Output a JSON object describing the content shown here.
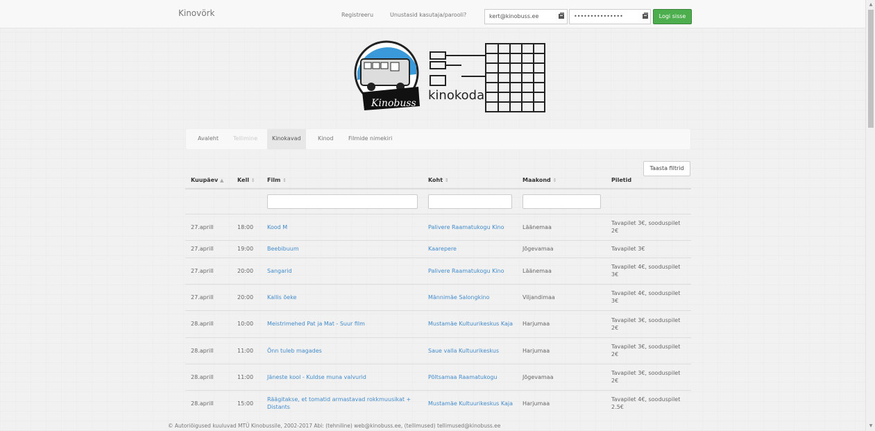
{
  "topbar": {
    "brand": "Kinovörk",
    "register": "Registreeru",
    "forgot": "Unustasid kasutaja/parooli?",
    "email_value": "kert@kinobuss.ee",
    "password_value": "•••••••••••••••",
    "login_label": "Logi sisse"
  },
  "logo": {
    "text": "kinokoda",
    "bus_text": "Kinobuss"
  },
  "tabs": [
    "Avaleht",
    "Tellimine",
    "Kinokavad",
    "Kinod",
    "Filmide nimekiri"
  ],
  "table": {
    "reset_label": "Taasta filtrid",
    "headers": [
      "Kuupäev",
      "Kell",
      "Film",
      "Koht",
      "Maakond",
      "Piletid"
    ],
    "sort_active": "▲",
    "sort_inactive": "⇕",
    "rows": [
      {
        "date": "27.aprill",
        "time": "18:00",
        "film": "Kood M",
        "place": "Palivere Raamatukogu Kino",
        "county": "Läänemaa",
        "tickets": "Tavapilet 3€, sooduspilet 2€"
      },
      {
        "date": "27.aprill",
        "time": "19:00",
        "film": "Beebibuum",
        "place": "Kaarepere",
        "county": "Jõgevamaa",
        "tickets": "Tavapilet 3€"
      },
      {
        "date": "27.aprill",
        "time": "20:00",
        "film": "Sangarid",
        "place": "Palivere Raamatukogu Kino",
        "county": "Läänemaa",
        "tickets": "Tavapilet 4€, sooduspilet 3€"
      },
      {
        "date": "27.aprill",
        "time": "20:00",
        "film": "Kallis õeke",
        "place": "Männimäe Salongkino",
        "county": "Viljandimaa",
        "tickets": "Tavapilet 4€, sooduspilet 3€"
      },
      {
        "date": "28.aprill",
        "time": "10:00",
        "film": "Meistrimehed Pat ja Mat - Suur film",
        "place": "Mustamäe Kultuurikeskus Kaja",
        "county": "Harjumaa",
        "tickets": "Tavapilet 3€, sooduspilet 2€"
      },
      {
        "date": "28.aprill",
        "time": "11:00",
        "film": "Õnn tuleb magades",
        "place": "Saue valla Kultuurikeskus",
        "county": "Harjumaa",
        "tickets": "Tavapilet 3€, sooduspilet 2€"
      },
      {
        "date": "28.aprill",
        "time": "11:00",
        "film": "Jäneste kool - Kuldse muna valvurid",
        "place": "Põltsamaa Raamatukogu",
        "county": "Jõgevamaa",
        "tickets": "Tavapilet 3€, sooduspilet 2€"
      },
      {
        "date": "28.aprill",
        "time": "15:00",
        "film": "Räägitakse, et tomatid armastavad rokkmuusikat + Distants",
        "place": "Mustamäe Kultuurikeskus Kaja",
        "county": "Harjumaa",
        "tickets": "Tavapilet 4€, sooduspilet 2.5€"
      }
    ]
  },
  "footer": "© Autoriõigused kuuluvad MTÜ Kinobussile, 2002-2017 Abi: (tehniline) web@kinobuss.ee, (tellimused) tellimused@kinobuss.ee",
  "colors": {
    "link": "#428bca",
    "login_button": "#4cae4c"
  }
}
